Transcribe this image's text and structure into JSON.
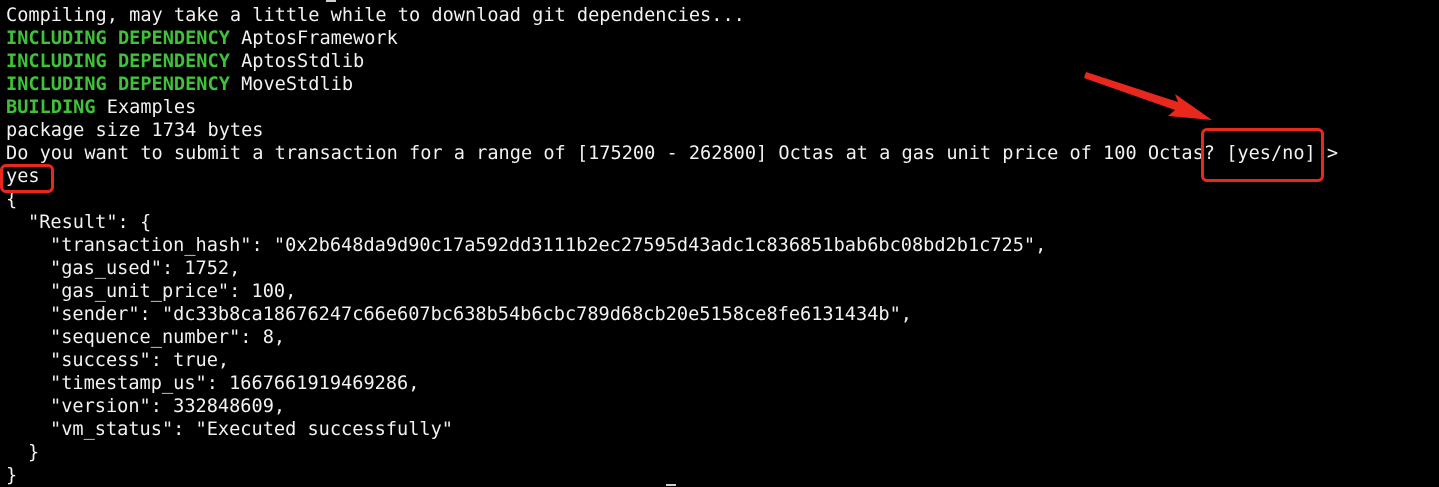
{
  "colors": {
    "background": "#000000",
    "text": "#f2f2f2",
    "status_green": "#3fc23a",
    "annotation_red": "#e8281c"
  },
  "lines": {
    "compiling": "Compiling, may take a little while to download git dependencies...",
    "dep1_keyword": "INCLUDING DEPENDENCY",
    "dep1_name": " AptosFramework",
    "dep2_keyword": "INCLUDING DEPENDENCY",
    "dep2_name": " AptosStdlib",
    "dep3_keyword": "INCLUDING DEPENDENCY",
    "dep3_name": " MoveStdlib",
    "building_keyword": "BUILDING",
    "building_name": " Examples",
    "package_size": "package size 1734 bytes",
    "prompt": "Do you want to submit a transaction for a range of [175200 - 262800] Octas at a gas unit price of 100 Octas? [yes/no] >",
    "user_input": "yes",
    "json_open": "{",
    "result_open": "\"Result\": {",
    "transaction_hash": "\"transaction_hash\": \"0x2b648da9d90c17a592dd3111b2ec27595d43adc1c836851bab6bc08bd2b1c725\",",
    "gas_used": "\"gas_used\": 1752,",
    "gas_unit_price": "\"gas_unit_price\": 100,",
    "sender": "\"sender\": \"dc33b8ca18676247c66e607bc638b54b6cbc789d68cb20e5158ce8fe6131434b\",",
    "sequence_number": "\"sequence_number\": 8,",
    "success": "\"success\": true,",
    "timestamp_us": "\"timestamp_us\": 1667661919469286,",
    "version": "\"version\": 332848609,",
    "vm_status": "\"vm_status\": \"Executed successfully\"",
    "result_close": "}",
    "json_close": "}"
  },
  "annotations": {
    "arrow_icon": "red-arrow-icon",
    "prompt_box": "yes-no-prompt-highlight",
    "input_box": "yes-input-highlight"
  }
}
